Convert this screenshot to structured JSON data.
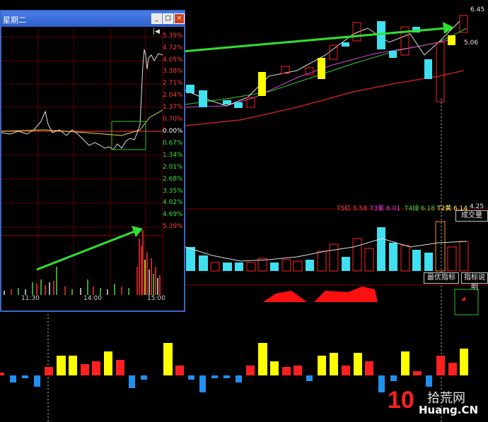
{
  "window": {
    "title": "星期二",
    "pin_glyph": "|◀",
    "minimize_glyph": "_",
    "maximize_glyph": "□",
    "close_glyph": "×",
    "pct_labels": [
      {
        "text": "5.39%",
        "color": "#ff4040"
      },
      {
        "text": "4.72%",
        "color": "#ff4040"
      },
      {
        "text": "4.05%",
        "color": "#ff4040"
      },
      {
        "text": "3.38%",
        "color": "#ff4040"
      },
      {
        "text": "2.71%",
        "color": "#ff4040"
      },
      {
        "text": "2.04%",
        "color": "#ff4040"
      },
      {
        "text": "1.37%",
        "color": "#ff4040"
      },
      {
        "text": "0.70%",
        "color": "#ff4040"
      },
      {
        "text": "0.00%",
        "color": "#ffffff"
      },
      {
        "text": "0.67%",
        "color": "#40e040"
      },
      {
        "text": "1.34%",
        "color": "#40e040"
      },
      {
        "text": "2.01%",
        "color": "#40e040"
      },
      {
        "text": "2.68%",
        "color": "#40e040"
      },
      {
        "text": "3.35%",
        "color": "#40e040"
      },
      {
        "text": "4.02%",
        "color": "#40e040"
      },
      {
        "text": "4.69%",
        "color": "#40e040"
      },
      {
        "text": "5.39%",
        "color": "#ff4040"
      }
    ],
    "time_labels": [
      "11:30",
      "14:00",
      "15:00"
    ]
  },
  "ma_legend": {
    "t5": "T5红 5.58",
    "t3": "T3紫 6.01",
    "t4": "T4绿 6.18",
    "t2": "T2黄 6.14",
    "extra": "4.25"
  },
  "price_labels": {
    "high": "6.45",
    "mid": "5.06"
  },
  "buttons": {
    "volume": "成交量",
    "best_indicator": "最优指标",
    "indicator_help": "指标说明"
  },
  "watermark": {
    "digit": "10",
    "brand": "拾荒网",
    "domain": "Huang.CN"
  },
  "colors": {
    "up": "#ff2020",
    "down": "#40e0f0",
    "yellow": "#ffff00",
    "window_border": "#3c66c6"
  }
}
